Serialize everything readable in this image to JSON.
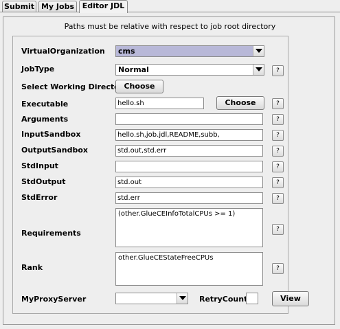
{
  "tabs": [
    {
      "label": "Submit"
    },
    {
      "label": "My Jobs"
    },
    {
      "label": "Editor JDL"
    }
  ],
  "notice": "Paths must be relative with respect to job root directory",
  "fields": {
    "virtual_organization": {
      "label": "VirtualOrganization",
      "value": "cms"
    },
    "job_type": {
      "label": "JobType",
      "value": "Normal"
    },
    "working_dir": {
      "label": "Select Working Directory",
      "button": "Choose"
    },
    "executable": {
      "label": "Executable",
      "value": "hello.sh",
      "button": "Choose"
    },
    "arguments": {
      "label": "Arguments",
      "value": ""
    },
    "input_sandbox": {
      "label": "InputSandbox",
      "value": "hello.sh,job.jdl,README,subb,"
    },
    "output_sandbox": {
      "label": "OutputSandbox",
      "value": "std.out,std.err"
    },
    "std_input": {
      "label": "StdInput",
      "value": ""
    },
    "std_output": {
      "label": "StdOutput",
      "value": "std.out"
    },
    "std_error": {
      "label": "StdError",
      "value": "std.err"
    },
    "requirements": {
      "label": "Requirements",
      "value": "(other.GlueCEInfoTotalCPUs >= 1)"
    },
    "rank": {
      "label": "Rank",
      "value": "other.GlueCEStateFreeCPUs"
    },
    "myproxy": {
      "label": "MyProxyServer",
      "value": ""
    },
    "retry_count": {
      "label": "RetryCount"
    },
    "view_button": "View"
  },
  "help_label": "?",
  "colors": {
    "selected_combo": "#b8b8d8",
    "background": "#eeeeee"
  }
}
